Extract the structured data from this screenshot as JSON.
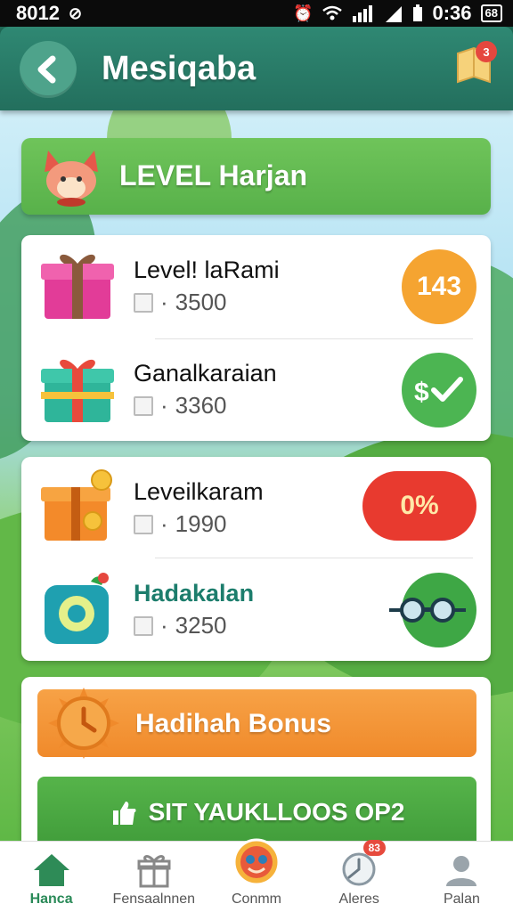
{
  "status_bar": {
    "time_left": "8012",
    "time_right": "0:36",
    "battery_label": "68"
  },
  "header": {
    "title": "Mesiqaba",
    "notification_count": "3"
  },
  "banner": {
    "title": "LEVEL Harjan"
  },
  "tasks_group_1": [
    {
      "title": "Level! laRami",
      "value": "3500",
      "badge": "143",
      "icon": "gift-pink-icon",
      "badge_style": "orange"
    },
    {
      "title": "Ganalkaraian",
      "value": "3360",
      "badge": "$✓",
      "icon": "gift-teal-icon",
      "badge_style": "green-check"
    }
  ],
  "tasks_group_2": [
    {
      "title": "Leveilkaram",
      "value": "1990",
      "badge": "0%",
      "icon": "gift-orange-icon",
      "badge_style": "red-pill"
    },
    {
      "title": "Hadakalan",
      "value": "3250",
      "badge": "",
      "icon": "camera-cube-icon",
      "badge_style": "goggles"
    }
  ],
  "bonus": {
    "label": "Hadihah Bonus",
    "start_label": "SIT YAUKLLOOS OP2"
  },
  "nav": {
    "items": [
      {
        "label": "Hanca",
        "icon": "home-icon"
      },
      {
        "label": "Fensaalnnen",
        "icon": "gift-box-icon"
      },
      {
        "label": "Conmm",
        "icon": "avatar-icon"
      },
      {
        "label": "Aleres",
        "icon": "clock-icon",
        "badge": "83"
      },
      {
        "label": "Palan",
        "icon": "user-icon"
      }
    ]
  },
  "colors": {
    "header": "#2f8873",
    "banner": "#62b94f",
    "orange": "#f5a431",
    "green": "#4cb552",
    "red": "#e83a2f"
  }
}
